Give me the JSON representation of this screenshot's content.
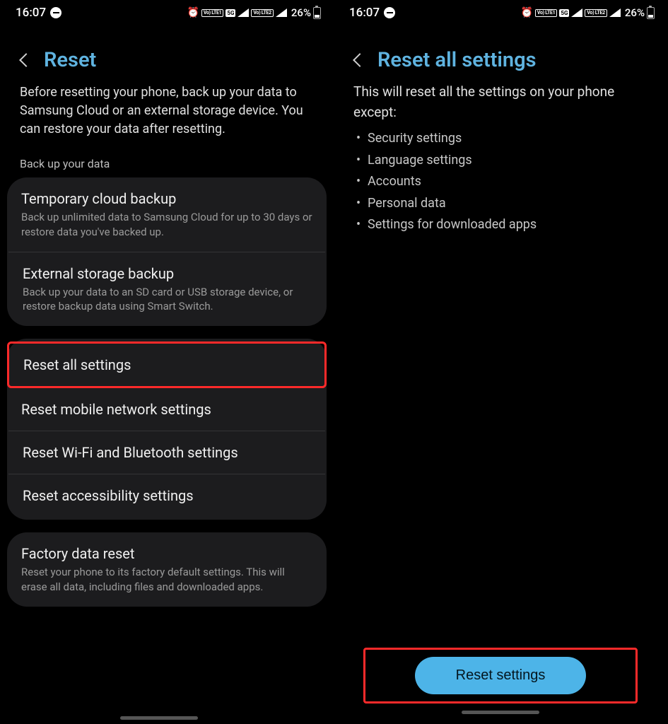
{
  "statusbar": {
    "time": "16:07",
    "sim1": "Vo) LTE1",
    "sim2": "Vo) LTE2",
    "net": "5G",
    "battery_pct": "26%"
  },
  "left": {
    "title": "Reset",
    "intro": "Before resetting your phone, back up your data to Samsung Cloud or an external storage device. You can restore your data after resetting.",
    "backup_label": "Back up your data",
    "backup_items": [
      {
        "title": "Temporary cloud backup",
        "desc": "Back up unlimited data to Samsung Cloud for up to 30 days or restore data you've backed up."
      },
      {
        "title": "External storage backup",
        "desc": "Back up your data to an SD card or USB storage device, or restore backup data using Smart Switch."
      }
    ],
    "reset_items": [
      {
        "title": "Reset all settings"
      },
      {
        "title": "Reset mobile network settings"
      },
      {
        "title": "Reset Wi-Fi and Bluetooth settings"
      },
      {
        "title": "Reset accessibility settings"
      }
    ],
    "factory": {
      "title": "Factory data reset",
      "desc": "Reset your phone to its factory default settings. This will erase all data, including files and downloaded apps."
    }
  },
  "right": {
    "title": "Reset all settings",
    "lead": "This will reset all the settings on your phone except:",
    "exceptions": [
      "Security settings",
      "Language settings",
      "Accounts",
      "Personal data",
      "Settings for downloaded apps"
    ],
    "cta": "Reset settings"
  }
}
